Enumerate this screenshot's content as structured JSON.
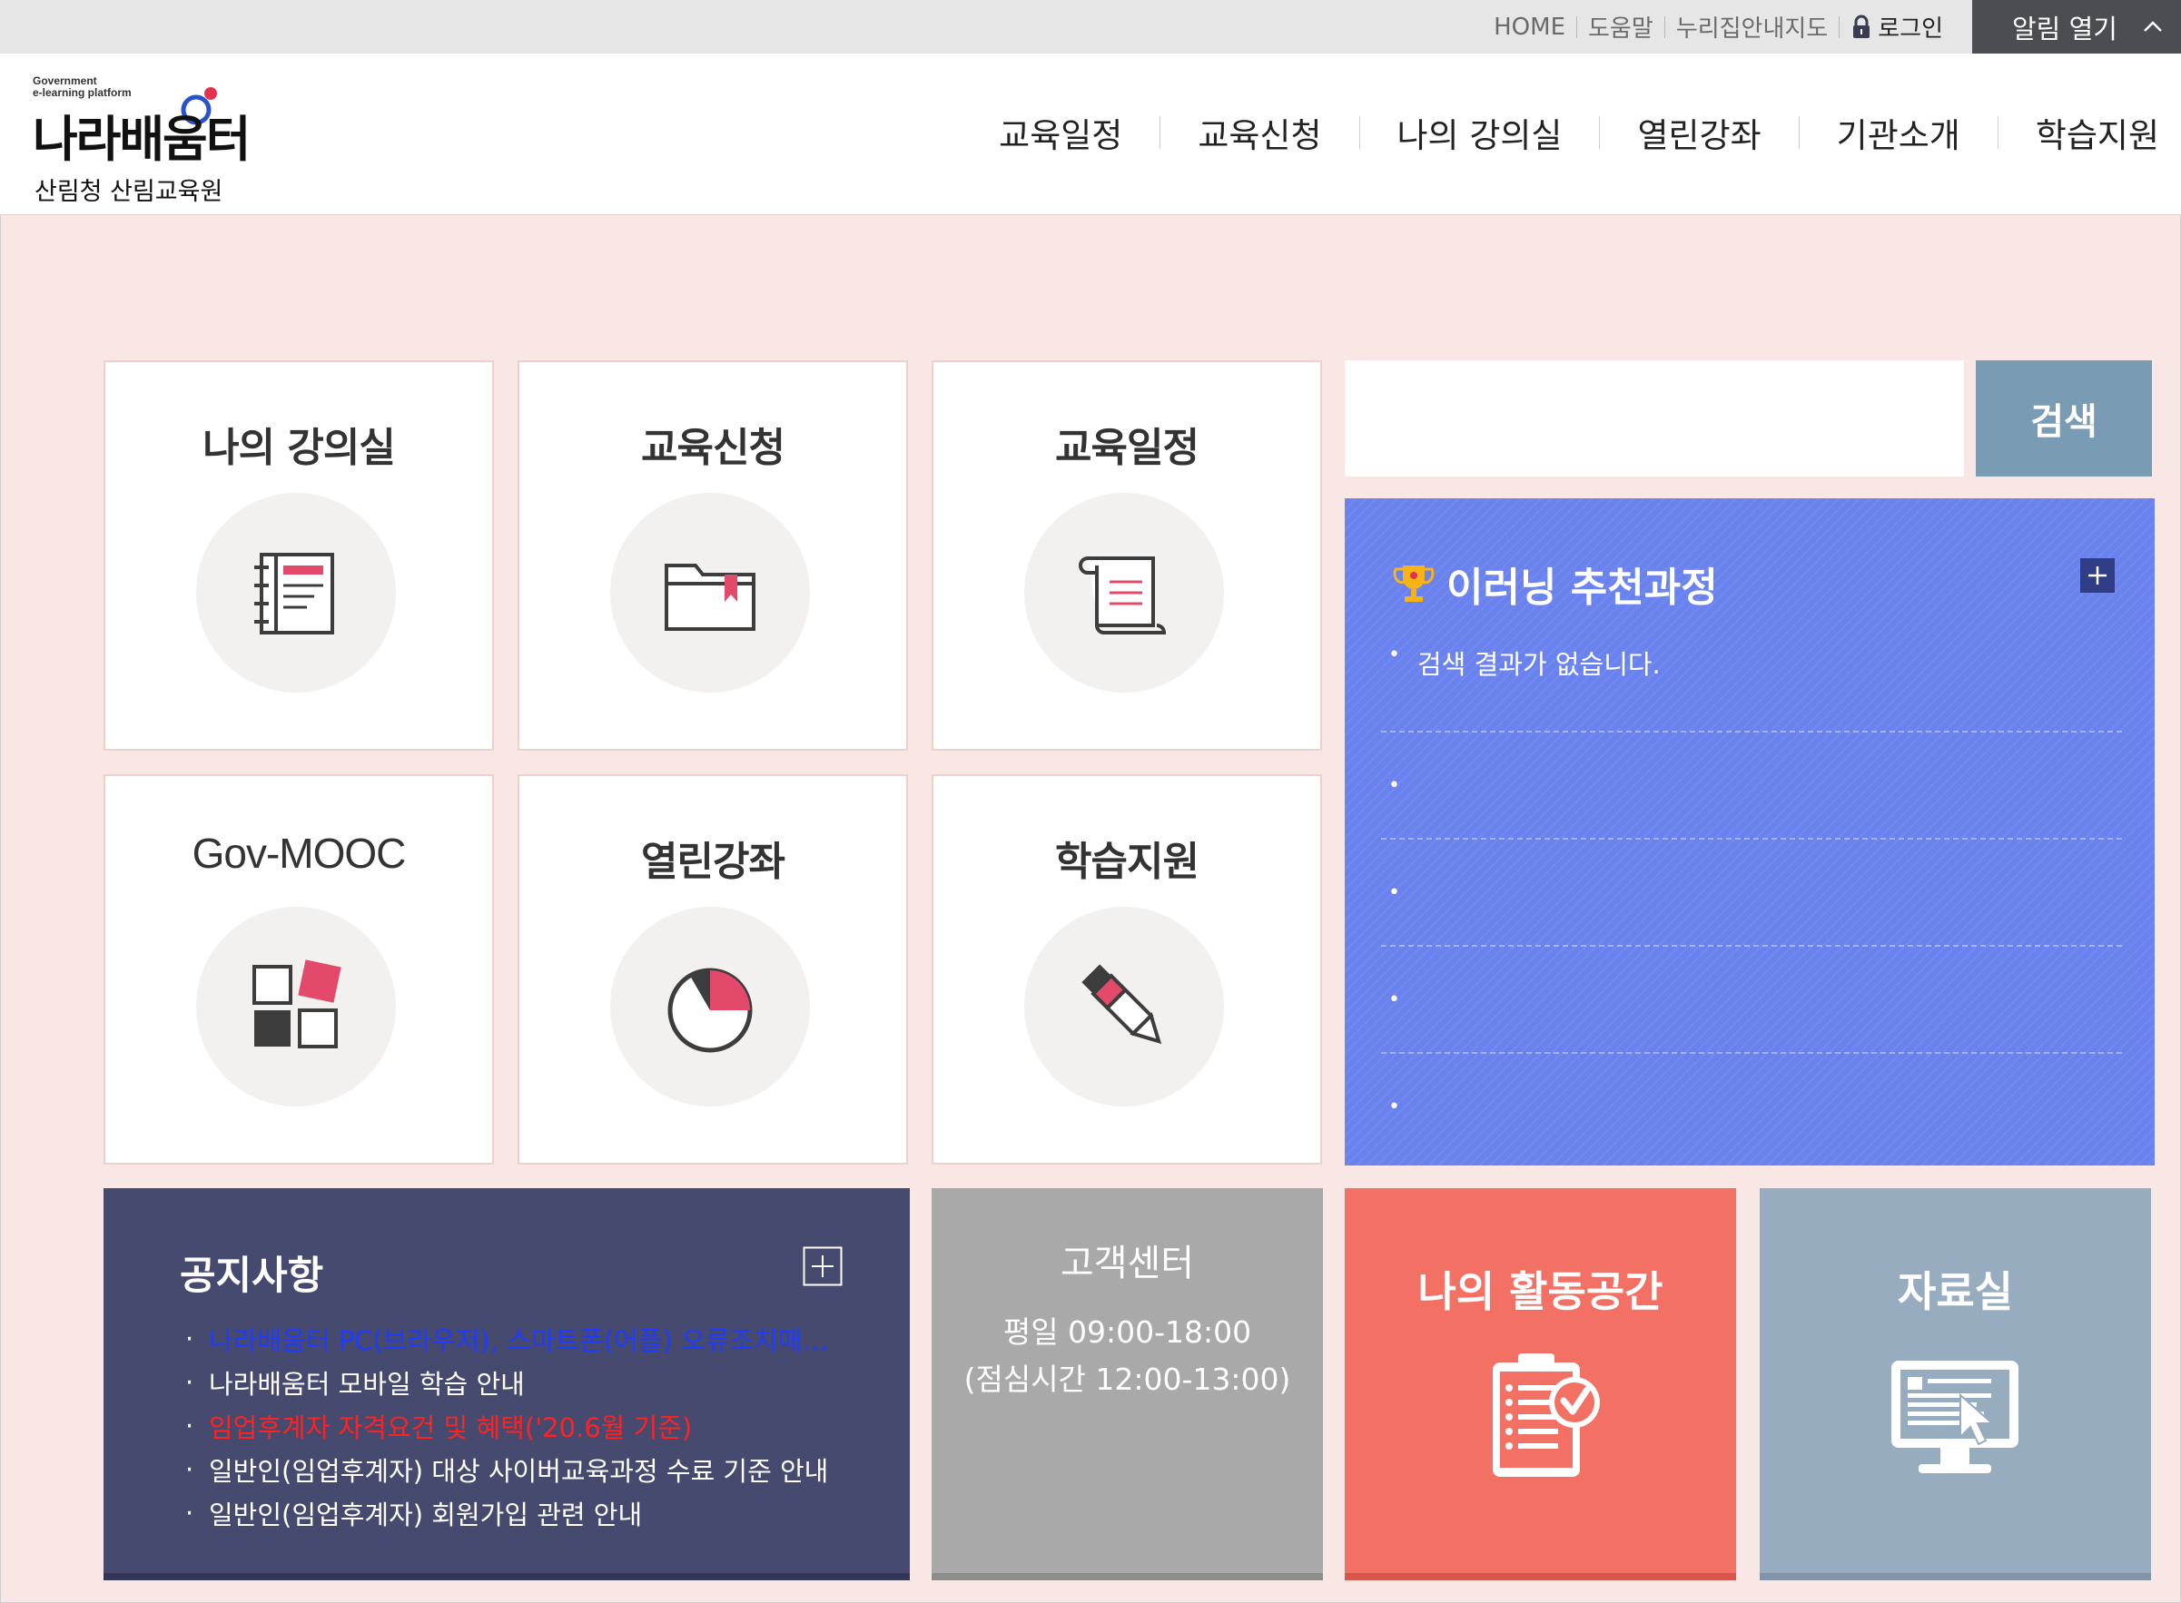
{
  "utility": {
    "home": "HOME",
    "help": "도움말",
    "sitemap": "누리집안내지도",
    "login": "로그인",
    "alarm": "알림 열기"
  },
  "logo": {
    "tagline_line1": "Government",
    "tagline_line2": "e-learning platform",
    "name": "나라배움터",
    "org": "산림청 산림교육원"
  },
  "nav": [
    "교육일정",
    "교육신청",
    "나의 강의실",
    "열린강좌",
    "기관소개",
    "학습지원"
  ],
  "tiles": [
    {
      "label": "나의 강의실",
      "icon": "notebook-icon"
    },
    {
      "label": "교육신청",
      "icon": "folder-icon"
    },
    {
      "label": "교육일정",
      "icon": "scroll-icon"
    },
    {
      "label": "Gov-MOOC",
      "icon": "blocks-icon"
    },
    {
      "label": "열린강좌",
      "icon": "pie-icon"
    },
    {
      "label": "학습지원",
      "icon": "pencil-icon"
    }
  ],
  "search": {
    "button": "검색",
    "value": ""
  },
  "recommend": {
    "title": "이러닝 추천과정",
    "items": [
      "검색 결과가 없습니다.",
      "",
      "",
      "",
      ""
    ]
  },
  "notice": {
    "title": "공지사항",
    "items": [
      {
        "text": "나라배움터 PC(브라우저), 스마트폰(어플) 오류조치매…",
        "color": "#1f3bff"
      },
      {
        "text": "나라배움터 모바일 학습 안내",
        "color": "#ffffff"
      },
      {
        "text": "임업후계자 자격요건 및 혜택('20.6월 기준)",
        "color": "#ff2222"
      },
      {
        "text": "일반인(임업후계자) 대상 사이버교육과정 수료 기준 안내",
        "color": "#ffffff"
      },
      {
        "text": "일반인(임업후계자) 회원가입 관련 안내",
        "color": "#ffffff"
      }
    ]
  },
  "customer_center": {
    "title": "고객센터",
    "hours": "평일 09:00-18:00",
    "lunch": "(점심시간 12:00-13:00)"
  },
  "activity": {
    "title": "나의 활동공간"
  },
  "archive": {
    "title": "자료실"
  },
  "colors": {
    "accent_pink": "#e2496a",
    "recommend_bg": "#6a82ee",
    "notice_bg": "#474a6f",
    "activity_bg": "#f37064",
    "archive_bg": "#97adbf",
    "search_btn": "#7a9bb4"
  }
}
